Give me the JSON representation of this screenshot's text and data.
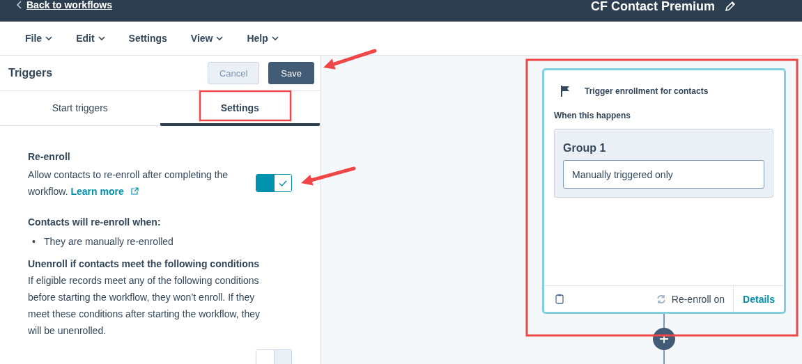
{
  "header": {
    "back_link": "Back to workflows",
    "workflow_name": "CF Contact Premium"
  },
  "menu": [
    {
      "label": "File",
      "dropdown": true
    },
    {
      "label": "Edit",
      "dropdown": true
    },
    {
      "label": "Settings",
      "dropdown": false
    },
    {
      "label": "View",
      "dropdown": true
    },
    {
      "label": "Help",
      "dropdown": true
    }
  ],
  "panel": {
    "title": "Triggers",
    "buttons": [
      {
        "label": "Cancel",
        "kind": "secondary"
      },
      {
        "label": "Save",
        "kind": "primary"
      }
    ],
    "tabs": [
      {
        "label": "Start triggers",
        "selected": false
      },
      {
        "label": "Settings",
        "selected": true
      }
    ],
    "reenroll": {
      "heading": "Re-enroll",
      "description": "Allow contacts to re-enroll after completing the workflow.",
      "link": "Learn more",
      "on": true
    },
    "conditions": {
      "heading": "Contacts will re-enroll when:",
      "items": [
        {
          "marker": "•",
          "text": "They are manually re-enrolled"
        }
      ]
    },
    "unenroll": {
      "heading": "Unenroll if contacts meet the following conditions",
      "description": "If eligible records meet any of the following conditions before starting the workflow, they won’t enroll. If they meet these conditions after starting the workflow, they will be unenrolled.",
      "on": false
    }
  },
  "canvas": {
    "card": {
      "title": "Trigger enrollment for contacts",
      "subtitle": "When this happens",
      "group": {
        "title": "Group 1",
        "criteria": "Manually triggered only"
      },
      "status": "Re-enroll on",
      "action": "Details"
    }
  }
}
